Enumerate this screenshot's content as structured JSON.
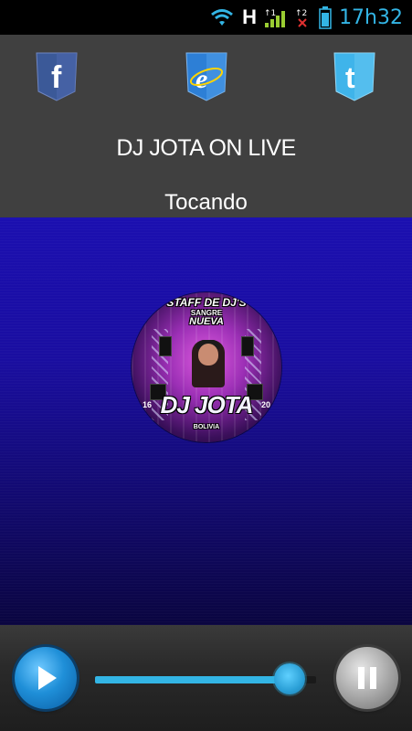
{
  "status_bar": {
    "network_label": "H",
    "clock": "17h32",
    "accent": "#33b5e5",
    "icons": [
      "wifi-icon",
      "signal-icon",
      "no-sim-icon",
      "battery-icon"
    ]
  },
  "header": {
    "social": [
      {
        "name": "facebook-icon",
        "glyph": "f",
        "color": "#3b5998"
      },
      {
        "name": "browser-icon",
        "glyph": "e",
        "color": "#2d7fd6"
      },
      {
        "name": "twitter-icon",
        "glyph": "t",
        "color": "#3fb4ea"
      }
    ],
    "title": "DJ JOTA ON LIVE",
    "subtitle": "Tocando"
  },
  "cover": {
    "line1": "STAFF DE DJ'S",
    "line2": "SANGRE",
    "line3": "NUEVA",
    "line4": "DJ JOTA",
    "line5": "BOLIVIA",
    "side_left": "16",
    "side_right": "20"
  },
  "player": {
    "progress": 0.88,
    "accent": "#33b5e5"
  }
}
